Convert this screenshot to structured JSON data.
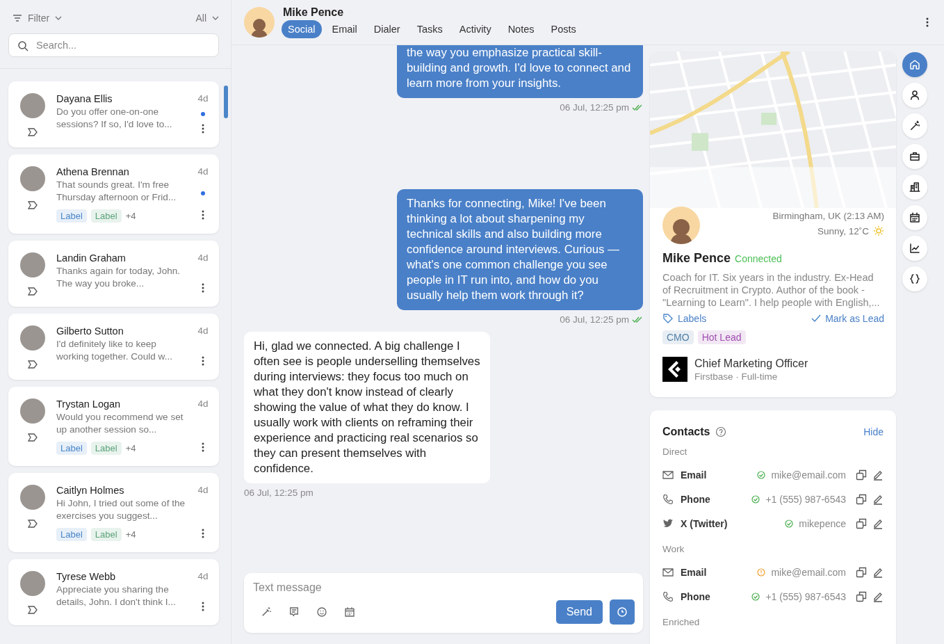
{
  "sidebar": {
    "filter": "Filter",
    "scope": "All",
    "search": {
      "placeholder": "Search..."
    },
    "conversations": [
      {
        "name": "Dayana Ellis",
        "preview": "Do you offer one-on-one sessions? If so, I'd love to...",
        "time": "4d",
        "unread": true,
        "selected": false
      },
      {
        "name": "Athena Brennan",
        "preview": "That sounds great. I'm free Thursday afternoon or Frid...",
        "time": "4d",
        "unread": true,
        "selected": false,
        "labels": [
          {
            "text": "Label",
            "color": "#4a86c8"
          },
          {
            "text": "Label",
            "color": "#5aa27a"
          }
        ],
        "more": "+4"
      },
      {
        "name": "Landin Graham",
        "preview": "Thanks again for today, John. The way you broke...",
        "time": "4d",
        "unread": false,
        "selected": false
      },
      {
        "name": "Gilberto Sutton",
        "preview": "I'd definitely like to keep working together. Could w...",
        "time": "4d",
        "unread": false,
        "selected": false
      },
      {
        "name": "Trystan Logan",
        "preview": "Would you recommend we set up another session so...",
        "time": "4d",
        "unread": false,
        "selected": false,
        "labels": [
          {
            "text": "Label",
            "color": "#4a86c8"
          },
          {
            "text": "Label",
            "color": "#5aa27a"
          }
        ],
        "more": "+4"
      },
      {
        "name": "Caitlyn Holmes",
        "preview": "Hi John, I tried out some of the exercises you suggest...",
        "time": "4d",
        "unread": false,
        "selected": false,
        "labels": [
          {
            "text": "Label",
            "color": "#4a86c8"
          },
          {
            "text": "Label",
            "color": "#5aa27a"
          }
        ],
        "more": "+4"
      },
      {
        "name": "Tyrese Webb",
        "preview": "Appreciate you sharing the details, John. I don't think I...",
        "time": "4d",
        "unread": false,
        "selected": false
      }
    ]
  },
  "header": {
    "name": "Mike Pence",
    "tabs": [
      {
        "label": "Social",
        "selected": true
      },
      {
        "label": "Email",
        "selected": false
      },
      {
        "label": "Dialer",
        "selected": false
      },
      {
        "label": "Tasks",
        "selected": false
      },
      {
        "label": "Activity",
        "selected": false
      },
      {
        "label": "Notes",
        "selected": false
      },
      {
        "label": "Posts",
        "selected": false
      }
    ]
  },
  "messages": [
    {
      "kind": "outgoing",
      "text": "the way you emphasize practical skill-building and growth. I'd love to connect and learn more from your insights.",
      "time": "06 Jul, 12:25 pm",
      "read": true
    },
    {
      "kind": "outgoing",
      "text": "Thanks for connecting, Mike! I've been thinking a lot about sharpening my technical skills and also building more confidence around interviews. Curious — what's one common challenge you see people in IT run into, and how do you usually help them work through it?",
      "time": "06 Jul, 12:25 pm",
      "read": true
    },
    {
      "kind": "incoming",
      "text": "Hi, glad we connected. A big challenge I often see is people underselling themselves during interviews: they focus too much on what they don't know instead of clearly showing the value of what they do know. I usually work with clients on reframing their experience and practicing real scenarios so they can present themselves with confidence.",
      "time": "06 Jul, 12:25 pm"
    }
  ],
  "composer": {
    "placeholder": "Text message",
    "send": "Send"
  },
  "profile": {
    "location": "Birmingham, UK (2:13 AM)",
    "weather": "Sunny, 12˚C",
    "name": "Mike Pence",
    "status": "Connected",
    "bio": "Coach for IT. Six years in the industry. Ex-Head of Recruitment in Crypto. Author of the book - \"Learning to Learn\". I help people with English,...",
    "labels_link": "Labels",
    "mark_lead": "Mark as Lead",
    "tags": [
      {
        "text": "CMO",
        "color": "#4f7fa8"
      },
      {
        "text": "Hot Lead",
        "color": "#a04fb0"
      }
    ],
    "job": {
      "title": "Chief Marketing Officer",
      "company": "Firstbase · Full-time"
    }
  },
  "contacts": {
    "title": "Contacts",
    "hide": "Hide",
    "groups": [
      {
        "name": "Direct",
        "items": [
          {
            "kind": "email",
            "label": "Email",
            "value": "mike@email.com",
            "verified": true
          },
          {
            "kind": "phone",
            "label": "Phone",
            "value": "+1 (555) 987-6543",
            "verified": true
          },
          {
            "kind": "twitter",
            "label": "X (Twitter)",
            "value": "mikepence",
            "verified": true
          }
        ]
      },
      {
        "name": "Work",
        "items": [
          {
            "kind": "email",
            "label": "Email",
            "value": "mike@email.com",
            "verified": false
          },
          {
            "kind": "phone",
            "label": "Phone",
            "value": "+1 (555) 987-6543",
            "verified": true
          }
        ]
      },
      {
        "name": "Enriched"
      }
    ]
  },
  "rail": [
    {
      "kind": "home",
      "selected": true
    },
    {
      "kind": "person",
      "selected": false
    },
    {
      "kind": "wand",
      "selected": false
    },
    {
      "kind": "briefcase",
      "selected": false
    },
    {
      "kind": "building",
      "selected": false
    },
    {
      "kind": "calendar",
      "selected": false
    },
    {
      "kind": "chart",
      "selected": false
    },
    {
      "kind": "braces",
      "selected": false
    }
  ]
}
